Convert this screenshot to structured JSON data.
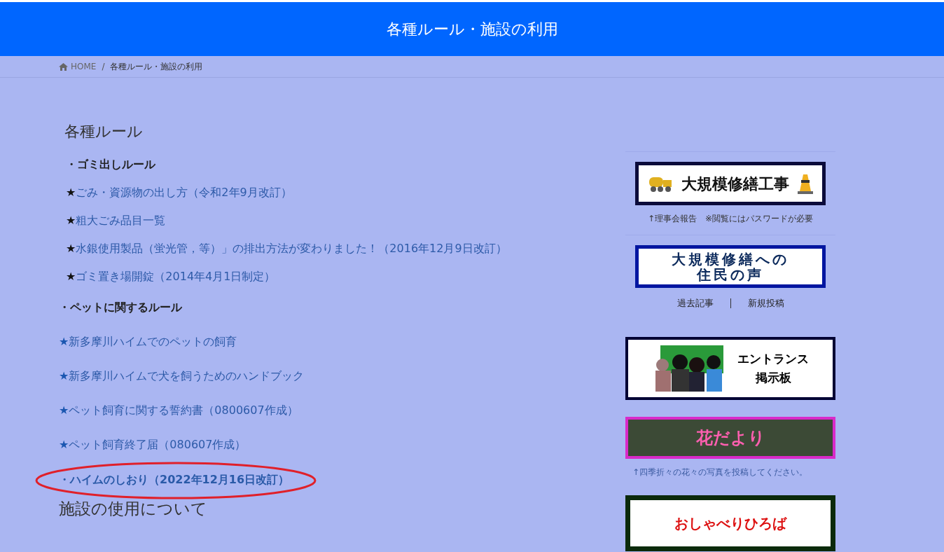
{
  "header": {
    "title": "各種ルール・施設の利用"
  },
  "breadcrumb_separator": "/",
  "breadcrumb": [
    {
      "label": "HOME",
      "kind": "home"
    },
    {
      "label": "各種ルール・施設の利用",
      "kind": "current"
    }
  ],
  "main": {
    "heading": "各種ルール",
    "sections": [
      {
        "title": "・ゴミ出しルール",
        "kind": "indented",
        "items": [
          {
            "mark": "★",
            "label": "ごみ・資源物の出し方（令和2年9月改訂）"
          },
          {
            "mark": "★",
            "label": "粗大ごみ品目一覧"
          },
          {
            "mark": "★",
            "label": "水銀使用製品（蛍光管，等）」の排出方法が変わりました！（2016年12月9日改訂）"
          },
          {
            "mark": "★",
            "label": "ゴミ置き場開錠（2014年4月1日制定）"
          }
        ]
      },
      {
        "title": "・ペットに関するルール",
        "kind": "flush",
        "items": [
          {
            "mark": "★",
            "label": "新多摩川ハイムでのペットの飼育"
          },
          {
            "mark": "★",
            "label": "新多摩川ハイムで犬を飼うためのハンドブック"
          },
          {
            "mark": "★",
            "label": "ペット飼育に関する誓約書（0800607作成）"
          },
          {
            "mark": "★",
            "label": "ペット飼育終了届（080607作成）"
          }
        ]
      }
    ],
    "highlight_link": {
      "label": "・ハイムのしおり（2022年12月16日改訂）",
      "circled": true
    },
    "heading2": "施設の使用について"
  },
  "sidebar": [
    {
      "kind": "construction",
      "lines": [
        "大規模修繕工事"
      ],
      "caption": {
        "text": "↑理事会報告　※閲覧にはパスワードが必要",
        "kind": "note"
      }
    },
    {
      "kind": "voice",
      "lines": [
        "大規模修繕への",
        "住民の声"
      ],
      "links": [
        "過去記事",
        "新規投稿"
      ]
    },
    {
      "kind": "entrance",
      "lines": [
        "エントランス",
        "掲示板"
      ]
    },
    {
      "kind": "flower",
      "lines": [
        "花だより"
      ],
      "caption": {
        "text": "↑四季折々の花々の写真を投稿してください。",
        "kind": "link"
      }
    },
    {
      "kind": "chat",
      "lines": [
        "おしゃべりひろば"
      ]
    }
  ]
}
